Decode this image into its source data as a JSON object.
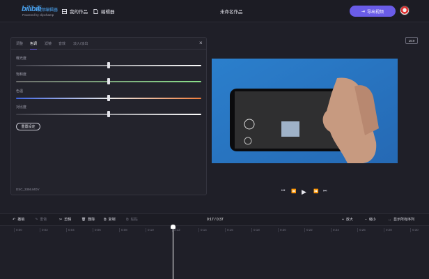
{
  "app": {
    "logo_mark": "bilibili",
    "logo_name": "视频编辑器",
    "logo_sub": "Powered by clipchamp"
  },
  "nav": {
    "my_works": "我的作品",
    "editor": "编辑器"
  },
  "doc_title": "未命名作品",
  "export_label": "导出视频",
  "aspect_ratio": "16:9",
  "panel": {
    "tabs": [
      "调整",
      "色调",
      "滤镜",
      "音效",
      "淡入/淡出"
    ],
    "active_tab": 1,
    "sliders": [
      {
        "label": "曝光度",
        "value": 0.5
      },
      {
        "label": "饱和度",
        "value": 0.5
      },
      {
        "label": "色温",
        "value": 0.5
      },
      {
        "label": "对比度",
        "value": 0.5
      }
    ],
    "reset_label": "重置设定",
    "filename": "DSC_3356.MOV"
  },
  "timeline": {
    "undo": "撤销",
    "redo": "重做",
    "split": "剪辑",
    "delete": "删除",
    "copy": "复制",
    "paste": "粘贴",
    "time": "0:17 / 0:37",
    "zoom_in": "放大",
    "zoom_out": "缩小",
    "fit": "显示所有序列",
    "ticks": [
      "0:00",
      "0:02",
      "0:04",
      "0:06",
      "0:08",
      "0:10",
      "0:12",
      "0:14",
      "0:16",
      "0:18",
      "0:20",
      "0:22",
      "0:24",
      "0:26",
      "0:28",
      "0:30",
      "0:32",
      "0:34",
      "0:36",
      "0:38"
    ]
  },
  "colors": {
    "accent": "#6a5ce8",
    "preview_bg": "#2e85cf"
  }
}
